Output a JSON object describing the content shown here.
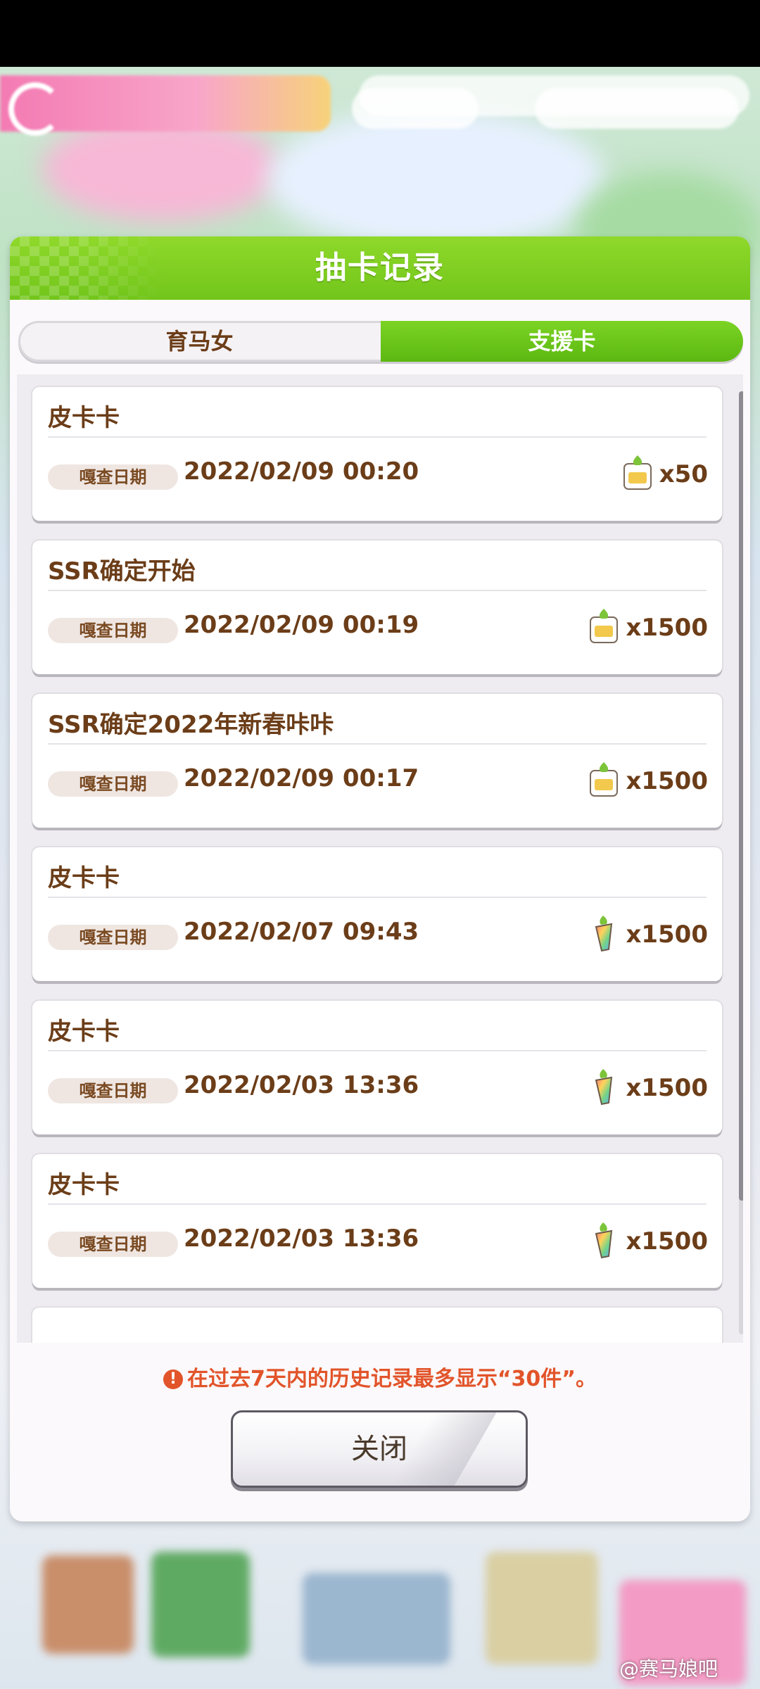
{
  "dialog": {
    "title": "抽卡记录",
    "tabs": [
      {
        "label": "育马女",
        "active": false
      },
      {
        "label": "支援卡",
        "active": true
      }
    ],
    "records": [
      {
        "title": "皮卡卡",
        "date_tag": "嘎查日期",
        "date": "2022/02/09 00:20",
        "cost_icon": "carat-ticket-icon",
        "cost": "x50"
      },
      {
        "title": "SSR确定开始",
        "date_tag": "嘎查日期",
        "date": "2022/02/09 00:19",
        "cost_icon": "carat-ticket-icon",
        "cost": "x1500"
      },
      {
        "title": "SSR确定2022年新春咔咔",
        "date_tag": "嘎查日期",
        "date": "2022/02/09 00:17",
        "cost_icon": "carat-ticket-icon",
        "cost": "x1500"
      },
      {
        "title": "皮卡卡",
        "date_tag": "嘎查日期",
        "date": "2022/02/07 09:43",
        "cost_icon": "rainbow-carat-icon",
        "cost": "x1500"
      },
      {
        "title": "皮卡卡",
        "date_tag": "嘎查日期",
        "date": "2022/02/03 13:36",
        "cost_icon": "rainbow-carat-icon",
        "cost": "x1500"
      },
      {
        "title": "皮卡卡",
        "date_tag": "嘎查日期",
        "date": "2022/02/03 13:36",
        "cost_icon": "rainbow-carat-icon",
        "cost": "x1500"
      }
    ],
    "notice": "在过去7天内的历史记录最多显示“30件”。",
    "close_label": "关闭"
  },
  "watermark": "@赛马娘吧",
  "colors": {
    "accent_green": "#72c51b",
    "text_brown": "#6b3d18",
    "notice_red": "#e2542a"
  }
}
